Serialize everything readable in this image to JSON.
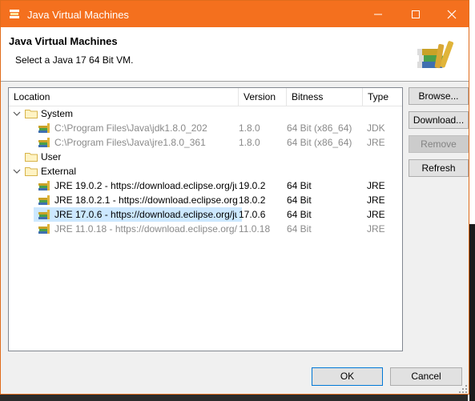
{
  "window": {
    "title": "Java Virtual Machines"
  },
  "header": {
    "title": "Java Virtual Machines",
    "subtitle": "Select a Java 17 64 Bit VM."
  },
  "table": {
    "columns": [
      "Location",
      "Version",
      "Bitness",
      "Type"
    ],
    "groups": {
      "system": "System",
      "user": "User",
      "external": "External"
    },
    "rows": [
      {
        "name": "C:\\Program Files\\Java\\jdk1.8.0_202",
        "version": "1.8.0",
        "bitness": "64 Bit (x86_64)",
        "type": "JDK"
      },
      {
        "name": "C:\\Program Files\\Java\\jre1.8.0_361",
        "version": "1.8.0",
        "bitness": "64 Bit (x86_64)",
        "type": "JRE"
      },
      {
        "name": "JRE 19.0.2 - https://download.eclipse.org/ju",
        "version": "19.0.2",
        "bitness": "64 Bit",
        "type": "JRE"
      },
      {
        "name": "JRE 18.0.2.1 - https://download.eclipse.org/",
        "version": "18.0.2",
        "bitness": "64 Bit",
        "type": "JRE"
      },
      {
        "name": "JRE 17.0.6 - https://download.eclipse.org/ju",
        "version": "17.0.6",
        "bitness": "64 Bit",
        "type": "JRE"
      },
      {
        "name": "JRE 11.0.18 - https://download.eclipse.org/",
        "version": "11.0.18",
        "bitness": "64 Bit",
        "type": "JRE"
      }
    ]
  },
  "buttons": {
    "browse": "Browse...",
    "download": "Download...",
    "remove": "Remove",
    "refresh": "Refresh",
    "ok": "OK",
    "cancel": "Cancel"
  },
  "colors": {
    "titlebar": "#f4701e",
    "selection": "#cce8ff"
  },
  "icons": [
    "app-icon",
    "minimize-icon",
    "maximize-icon",
    "close-icon",
    "books-icon",
    "folder-icon",
    "jre-icon",
    "chevron-down-icon"
  ]
}
